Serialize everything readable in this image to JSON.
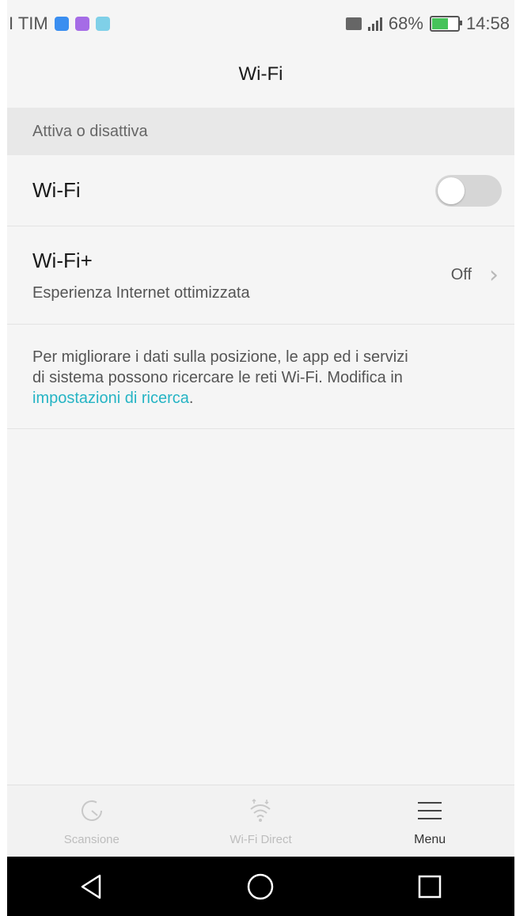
{
  "status_bar": {
    "carrier": "I TIM",
    "signal_percent": "68%",
    "time": "14:58",
    "battery_level": 0.68,
    "notification_icons": [
      "messenger-icon",
      "viber-icon",
      "messages-icon"
    ]
  },
  "header": {
    "title": "Wi-Fi"
  },
  "section": {
    "label": "Attiva o disattiva"
  },
  "wifi_row": {
    "title": "Wi-Fi",
    "toggle_on": false
  },
  "wifiplus_row": {
    "title": "Wi-Fi+",
    "subtitle": "Esperienza Internet ottimizzata",
    "value": "Off"
  },
  "info": {
    "line1": "Per migliorare i dati sulla posizione, le app ed i servizi",
    "line2": "di sistema possono ricercare le reti Wi-Fi. Modifica in",
    "link_text": "impostazioni di ricerca",
    "after_link": "."
  },
  "actions": [
    {
      "label": "Scansione",
      "icon": "refresh-icon",
      "active": false
    },
    {
      "label": "Wi-Fi Direct",
      "icon": "wifi-direct-icon",
      "active": false
    },
    {
      "label": "Menu",
      "icon": "menu-icon",
      "active": true
    }
  ],
  "nav": {
    "icons": [
      "back-icon",
      "home-icon",
      "recents-icon"
    ]
  },
  "colors": {
    "accent_link": "#25b4c4",
    "battery_fill": "#46c35a"
  }
}
